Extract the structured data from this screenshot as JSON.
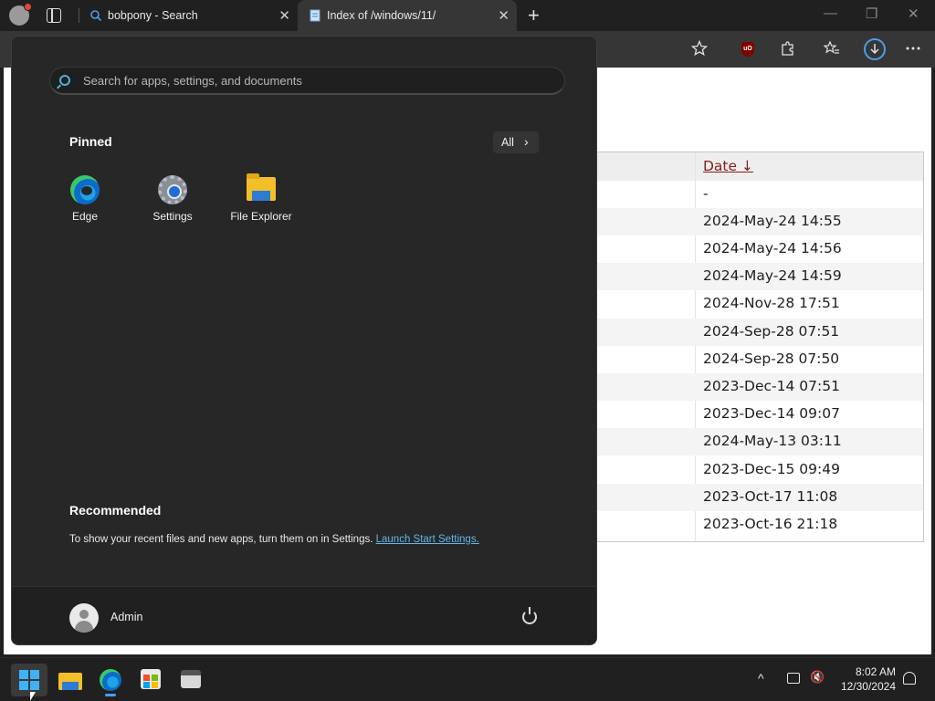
{
  "browser": {
    "tabs": [
      {
        "title": "bobpony - Search"
      },
      {
        "title": "Index of /windows/11/"
      }
    ],
    "close_glyph": "✕",
    "new_tab_glyph": "+",
    "window_controls": {
      "minimize": "—",
      "restore": "❐",
      "close": "✕"
    }
  },
  "directory_listing": {
    "date_header": "Date ↓",
    "rows": [
      "-",
      "2024-May-24 14:55",
      "2024-May-24 14:56",
      "2024-May-24 14:59",
      "2024-Nov-28 17:51",
      "2024-Sep-28 07:51",
      "2024-Sep-28 07:50",
      "2023-Dec-14 07:51",
      "2023-Dec-14 09:07",
      "2024-May-13 03:11",
      "2023-Dec-15 09:49",
      "2023-Oct-17 11:08",
      "2023-Oct-16 21:18"
    ]
  },
  "start_menu": {
    "search_placeholder": "Search for apps, settings, and documents",
    "pinned_title": "Pinned",
    "all_button": "All",
    "all_chevron": "›",
    "pinned": [
      {
        "label": "Edge",
        "icon": "edge-icon"
      },
      {
        "label": "Settings",
        "icon": "gear-icon"
      },
      {
        "label": "File Explorer",
        "icon": "folder-icon"
      }
    ],
    "recommended_title": "Recommended",
    "recommended_text": "To show your recent files and new apps, turn them on in Settings. ",
    "recommended_link": "Launch Start Settings.",
    "user_name": "Admin"
  },
  "taskbar": {
    "time": "8:02 AM",
    "date": "12/30/2024",
    "tray_chevron": "^"
  },
  "colors": {
    "accent": "#4db3d6",
    "link": "#62b6e6",
    "date_header": "#8b1a1a",
    "start_background": "#272727"
  }
}
